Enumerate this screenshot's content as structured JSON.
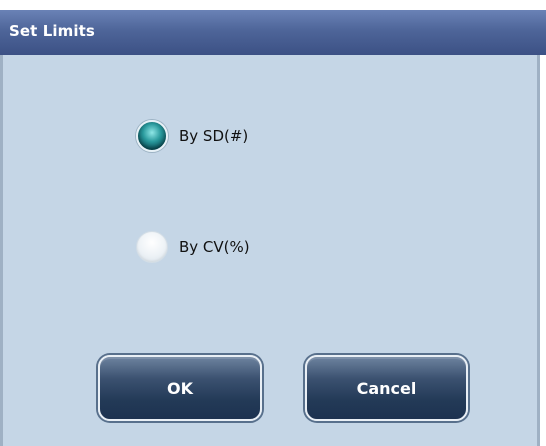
{
  "dialog": {
    "title": "Set Limits"
  },
  "options": [
    {
      "label": "By SD(#)",
      "selected": true
    },
    {
      "label": "By CV(%)",
      "selected": false
    }
  ],
  "buttons": {
    "ok_label": "OK",
    "cancel_label": "Cancel"
  },
  "colors": {
    "title_bar": "#4e6599",
    "dialog_background": "#c5d6e6",
    "button_fill": "#2c4463",
    "radio_selected": "#1a7a80"
  }
}
